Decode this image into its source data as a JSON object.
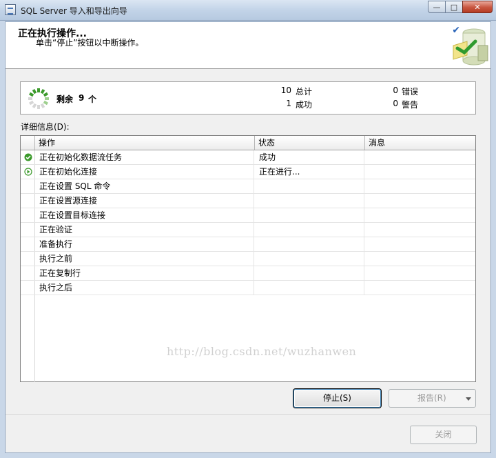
{
  "window": {
    "title": "SQL Server 导入和导出向导"
  },
  "header": {
    "title": "正在执行操作...",
    "subtitle": "单击“停止”按钮以中断操作。"
  },
  "progress": {
    "remaining_label": "剩余",
    "remaining_count": "9",
    "remaining_unit": "个",
    "total_count": "10",
    "total_label": "总计",
    "success_count": "1",
    "success_label": "成功",
    "error_count": "0",
    "error_label": "错误",
    "warning_count": "0",
    "warning_label": "警告"
  },
  "details": {
    "label": "详细信息(D):",
    "columns": {
      "operation": "操作",
      "status": "状态",
      "message": "消息"
    },
    "rows": [
      {
        "operation": "正在初始化数据流任务",
        "status": "成功",
        "message": "",
        "icon": "success-check-icon"
      },
      {
        "operation": "正在初始化连接",
        "status": "正在进行...",
        "message": "",
        "icon": "in-progress-arrow-icon"
      },
      {
        "operation": "正在设置 SQL 命令",
        "status": "",
        "message": "",
        "icon": ""
      },
      {
        "operation": "正在设置源连接",
        "status": "",
        "message": "",
        "icon": ""
      },
      {
        "operation": "正在设置目标连接",
        "status": "",
        "message": "",
        "icon": ""
      },
      {
        "operation": "正在验证",
        "status": "",
        "message": "",
        "icon": ""
      },
      {
        "operation": "准备执行",
        "status": "",
        "message": "",
        "icon": ""
      },
      {
        "operation": "执行之前",
        "status": "",
        "message": "",
        "icon": ""
      },
      {
        "operation": "正在复制行",
        "status": "",
        "message": "",
        "icon": ""
      },
      {
        "operation": "执行之后",
        "status": "",
        "message": "",
        "icon": ""
      }
    ]
  },
  "watermark": "http://blog.csdn.net/wuzhanwen",
  "buttons": {
    "stop": "停止(S)",
    "report": "报告(R)",
    "close": "关闭"
  },
  "colors": {
    "success": "#3c9a2c",
    "header_bg": "#ffffff",
    "dialog_bg": "#f0f0f0"
  }
}
